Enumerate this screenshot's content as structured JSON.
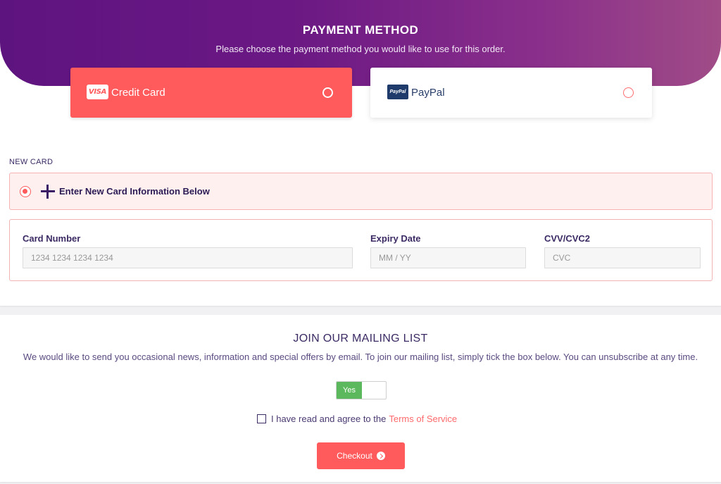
{
  "header": {
    "title": "PAYMENT METHOD",
    "subtitle": "Please choose the payment method you would like to use for this order."
  },
  "methods": [
    {
      "label": "Credit Card",
      "badge": "VISA",
      "selected": true,
      "icon": "visa-icon"
    },
    {
      "label": "PayPal",
      "badge": "PayPal",
      "selected": false,
      "icon": "paypal-icon"
    }
  ],
  "new_card": {
    "section_label": "NEW CARD",
    "option_text": "Enter New Card Information Below"
  },
  "card_form": {
    "card_number": {
      "label": "Card Number",
      "placeholder": "1234 1234 1234 1234",
      "value": ""
    },
    "expiry": {
      "label": "Expiry Date",
      "placeholder": "MM / YY",
      "value": ""
    },
    "cvv": {
      "label": "CVV/CVC2",
      "placeholder": "CVC",
      "value": ""
    }
  },
  "mailing": {
    "title": "JOIN OUR MAILING LIST",
    "text": "We would like to send you occasional news, information and special offers by email. To join our mailing list, simply tick the box below. You can unsubscribe at any time.",
    "toggle_label": "Yes",
    "toggle_on": true
  },
  "terms": {
    "prefix": "I have read and agree to the",
    "link": "Terms of Service",
    "checked": false
  },
  "checkout": {
    "label": "Checkout",
    "icon": "arrow-circle-right-icon"
  },
  "colors": {
    "accent": "#ff5a5c",
    "purple": "#5e147f",
    "toggle_green": "#5cb85c"
  }
}
